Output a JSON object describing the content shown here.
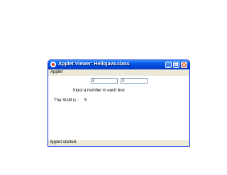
{
  "window": {
    "title": "Applet Viewer: Hellojava.class",
    "icon": "java-icon",
    "controls": [
      "minimize-icon",
      "maximize-icon",
      "close-icon"
    ]
  },
  "menubar": {
    "items": [
      {
        "label": "Applet"
      }
    ]
  },
  "applet": {
    "field_a_value": "2",
    "field_b_value": "3",
    "prompt": "Input a number in each box",
    "sum_label": "The SUM is :",
    "sum_value": "5"
  },
  "status": {
    "text": "Applet started."
  },
  "colors": {
    "titlebar": "#0a5fe8",
    "frame": "#ece9d8",
    "close_button": "#c43a18"
  }
}
